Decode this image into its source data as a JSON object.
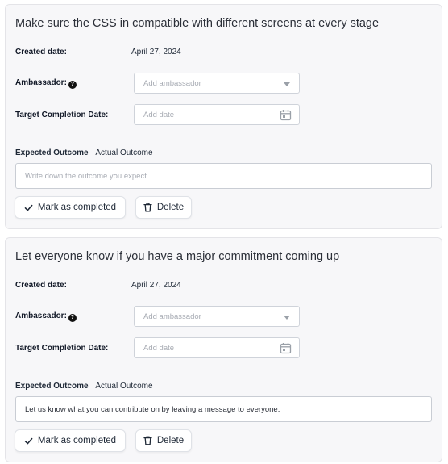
{
  "tasks": [
    {
      "title": "Make sure the CSS in compatible with different screens at every stage",
      "created_label": "Created date:",
      "created_value": "April 27, 2024",
      "ambassador_label": "Ambassador:",
      "ambassador_placeholder": "Add ambassador",
      "target_label": "Target Completion Date:",
      "target_placeholder": "Add date",
      "tab_expected": "Expected Outcome",
      "tab_actual": "Actual Outcome",
      "outcome_placeholder": "Write down the outcome you expect",
      "outcome_value": "",
      "complete_label": "Mark as completed",
      "delete_label": "Delete"
    },
    {
      "title": "Let everyone know if you have a major commitment coming up",
      "created_label": "Created date:",
      "created_value": "April 27, 2024",
      "ambassador_label": "Ambassador:",
      "ambassador_placeholder": "Add ambassador",
      "target_label": "Target Completion Date:",
      "target_placeholder": "Add date",
      "tab_expected": "Expected Outcome",
      "tab_actual": "Actual Outcome",
      "outcome_placeholder": "",
      "outcome_value": "Let us know what you can contribute on by leaving a message to everyone.",
      "complete_label": "Mark as completed",
      "delete_label": "Delete"
    }
  ],
  "icons": {
    "help": "question-circle-icon",
    "caret": "chevron-down-icon",
    "calendar": "calendar-icon",
    "check": "check-icon",
    "trash": "trash-icon"
  }
}
